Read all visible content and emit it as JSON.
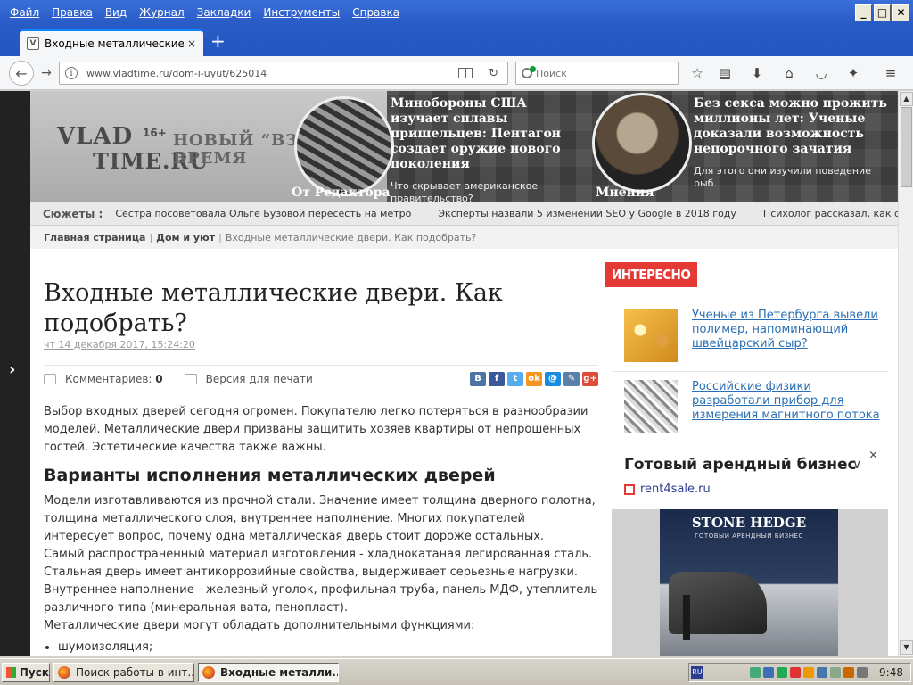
{
  "menu": [
    "Файл",
    "Правка",
    "Вид",
    "Журнал",
    "Закладки",
    "Инструменты",
    "Справка"
  ],
  "window_controls": {
    "minimize": "_",
    "maximize": "□",
    "close": "✕"
  },
  "tab": {
    "title": "Входные металлические дв...",
    "close": "×"
  },
  "new_tab": "+",
  "nav": {
    "url": "www.vladtime.ru/dom-i-uyut/625014",
    "search_placeholder": "Поиск",
    "icons": [
      "back-arrow-icon",
      "forward-arrow-icon",
      "info-icon",
      "reader-view-icon",
      "reload-icon",
      "star-icon",
      "library-icon",
      "download-icon",
      "home-icon",
      "pocket-icon",
      "extension-icon",
      "menu-icon"
    ]
  },
  "site": {
    "logo_line1": "VLAD",
    "logo_line2": "TIME.RU",
    "logo_age": "16+",
    "logo_slogan": "НОВЫЙ “ВЗГЛ НА ВРЕМЯ",
    "header_stories": [
      {
        "category": "От Редактора",
        "title": "Минобороны США изучает сплавы пришельцев: Пентагон создает оружие нового поколения",
        "subtitle": "Что скрывает американское правительство?"
      },
      {
        "category": "Мнения",
        "title": "Без секса можно прожить миллионы лет: Ученые доказали возможность непорочного зачатия",
        "subtitle": "Для этого они изучили поведение рыб."
      }
    ],
    "ticker": {
      "label": "Сюжеты :",
      "items": [
        "Сестра посоветовала Ольге Бузовой пересесть на метро",
        "Эксперты назвали 5 изменений SEO у Google в 2018 году",
        "Психолог рассказал, как сохранить мир за г"
      ]
    },
    "breadcrumbs": {
      "home": "Главная страница",
      "section": "Дом и уют",
      "current": "Входные металлические двери. Как подобрать?",
      "separator": "|"
    }
  },
  "article": {
    "title": "Входные металлические двери. Как подобрать?",
    "date": "чт 14 декабря 2017, 15:24:20",
    "comments_label": "Комментариев:",
    "comments_count": "0",
    "print_label": "Версия для печати",
    "share_buttons": [
      {
        "name": "vk",
        "glyph": "В",
        "color": "#4c75a3"
      },
      {
        "name": "facebook",
        "glyph": "f",
        "color": "#3b5998"
      },
      {
        "name": "twitter",
        "glyph": "t",
        "color": "#55acee"
      },
      {
        "name": "odnoklassniki",
        "glyph": "ok",
        "color": "#f7931e"
      },
      {
        "name": "mailru",
        "glyph": "@",
        "color": "#168de2"
      },
      {
        "name": "livejournal",
        "glyph": "✎",
        "color": "#5b7fa6"
      },
      {
        "name": "googleplus",
        "glyph": "g+",
        "color": "#dd4b39"
      }
    ],
    "intro": "Выбор входных дверей сегодня огромен. Покупателю легко потеряться в разнообразии моделей. Металлические двери призваны защитить хозяев квартиры от непрошенных гостей. Эстетические качества также важны.",
    "h2": "Варианты исполнения металлических дверей",
    "paragraphs": [
      "Модели изготавливаются из прочной стали. Значение имеет толщина дверного полотна, толщина металлического слоя, внутреннее наполнение. Многих покупателей интересует вопрос, почему одна металлическая дверь стоит дороже остальных.",
      "Самый распространенный материал изготовления - хладнокатаная легированная сталь. Стальная дверь имеет антикоррозийные свойства, выдерживает серьезные нагрузки.",
      "Внутреннее наполнение - железный уголок, профильная труба, панель МДФ, утеплитель различного типа (минеральная вата, пенопласт).",
      "Металлические двери могут обладать дополнительными функциями:"
    ],
    "list": [
      "шумоизоляция;"
    ]
  },
  "interesting": {
    "badge": "ИНТЕРЕСНО",
    "items": [
      {
        "text": "Ученые из Петербурга вывели полимер, напоминающий швейцарский сыр?"
      },
      {
        "text": "Российские физики разработали прибор для измерения магнитного потока"
      }
    ]
  },
  "ad": {
    "title": "Готовый арендный бизнес",
    "domain": "rent4sale.ru",
    "brand": "STONE HEDGE",
    "tagline": "ГОТОВЫЙ АРЕНДНЫЙ БИЗНЕС",
    "close": "×",
    "chevron": "∨"
  },
  "taskbar": {
    "start": "Пуск",
    "tasks": [
      "Поиск работы в инт...",
      "Входные металли..."
    ],
    "lang": "RU",
    "clock": "9:48"
  },
  "sidebar_arrow": "›",
  "scroll": {
    "up": "▲",
    "down": "▼"
  }
}
